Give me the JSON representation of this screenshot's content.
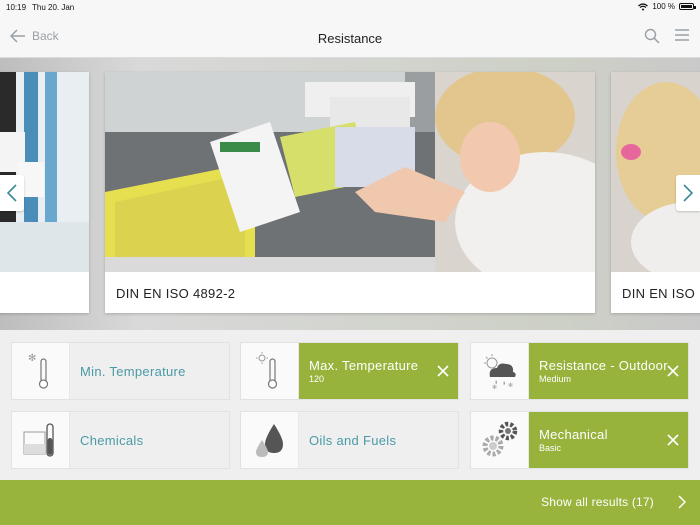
{
  "status": {
    "time": "10:19",
    "date": "Thu 20. Jan",
    "battery": "100 %",
    "battery_level": 1.0
  },
  "nav": {
    "back_label": "Back",
    "title": "Resistance",
    "icons": [
      "search-icon",
      "menu-icon"
    ]
  },
  "carousel": {
    "cards": [
      {
        "label": ""
      },
      {
        "label": "DIN EN ISO 4892-2"
      },
      {
        "label": "DIN EN ISO"
      }
    ]
  },
  "filters": [
    {
      "name": "Min. Temperature",
      "sub": "",
      "active": false,
      "icon": "snow-thermometer-icon"
    },
    {
      "name": "Max. Temperature",
      "sub": "120",
      "active": true,
      "icon": "sun-thermometer-icon"
    },
    {
      "name": "Resistance - Outdoor",
      "sub": "Medium",
      "active": true,
      "icon": "weather-icon"
    },
    {
      "name": "Chemicals",
      "sub": "",
      "active": false,
      "icon": "test-tube-icon"
    },
    {
      "name": "Oils and Fuels",
      "sub": "",
      "active": false,
      "icon": "drops-icon"
    },
    {
      "name": "Mechanical",
      "sub": "Basic",
      "active": true,
      "icon": "gears-icon"
    }
  ],
  "footer": {
    "results_label": "Show all results (17)"
  },
  "colors": {
    "accent": "#97b33c",
    "link": "#4a9aa6",
    "arrow": "#3a8a96"
  }
}
